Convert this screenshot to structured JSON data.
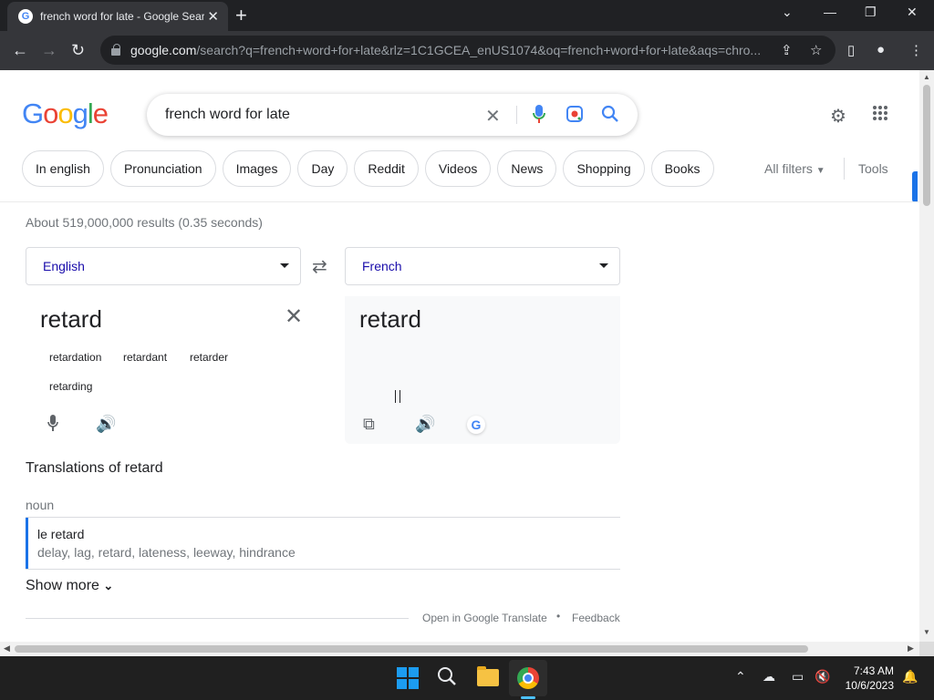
{
  "browser": {
    "tab_title": "french word for late - Google Search",
    "tab_favicon": "G",
    "url_host": "google.com",
    "url_rest": "/search?q=french+word+for+late&rlz=1C1GCEA_enUS1074&oq=french+word+for+late&aqs=chro..."
  },
  "search": {
    "logo": "Google",
    "query": "french word for late"
  },
  "chips": [
    "In english",
    "Pronunciation",
    "Images",
    "Day",
    "Reddit",
    "Videos",
    "News",
    "Shopping",
    "Books"
  ],
  "filters": {
    "all_filters": "All filters",
    "tools": "Tools"
  },
  "stats": "About 519,000,000 results (0.35 seconds)",
  "translator": {
    "source_lang": "English",
    "target_lang": "French",
    "source_word": "retard",
    "target_word": "retard",
    "suggestions": [
      "retardation",
      "retardant",
      "retarder",
      "retarding"
    ]
  },
  "translations": {
    "heading": "Translations of retard",
    "part_of_speech": "noun",
    "entry_word": "le retard",
    "entry_synonyms": "delay, lag, retard, lateness, leeway, hindrance",
    "show_more": "Show more",
    "open_in": "Open in Google Translate",
    "feedback": "Feedback"
  },
  "taskbar": {
    "time": "7:43 AM",
    "date": "10/6/2023"
  },
  "colors": {
    "google_blue": "#4285f4",
    "google_red": "#ea4335",
    "google_yellow": "#fbbc05",
    "google_green": "#34a853",
    "accent": "#1a73e8"
  }
}
